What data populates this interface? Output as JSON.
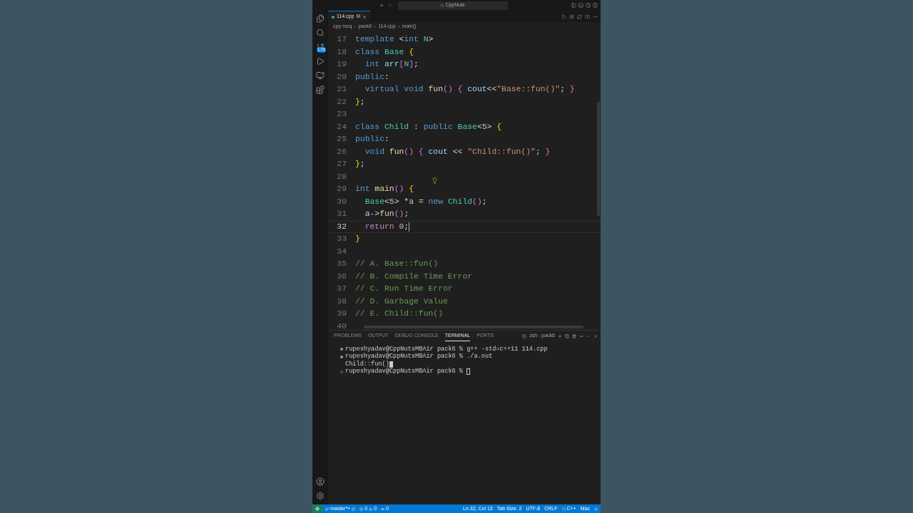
{
  "title_bar": {
    "search": "CppNuts"
  },
  "activity_bar": {
    "scm_badge": "176"
  },
  "tabs": [
    {
      "label": "114.cpp",
      "status": "M",
      "selected": true
    }
  ],
  "breadcrumbs": [
    "cpp mcq",
    "pack6",
    "114.cpp",
    "main()"
  ],
  "editor": {
    "lines": [
      {
        "number": "17",
        "current": false,
        "tokens": [
          {
            "text": "template",
            "kind": "kw"
          },
          {
            "text": " <",
            "kind": "p"
          },
          {
            "text": "int",
            "kind": "kw"
          },
          {
            "text": " N",
            "kind": "type"
          },
          {
            "text": ">",
            "kind": "p"
          }
        ]
      },
      {
        "number": "18",
        "current": false,
        "tokens": [
          {
            "text": "class",
            "kind": "kw"
          },
          {
            "text": " Base",
            "kind": "type"
          },
          {
            "text": " {",
            "kind": "b1"
          }
        ]
      },
      {
        "number": "19",
        "current": false,
        "tokens": [
          {
            "text": "  int",
            "kind": "kw"
          },
          {
            "text": " arr",
            "kind": "var"
          },
          {
            "text": "[",
            "kind": "b2"
          },
          {
            "text": "N",
            "kind": "type"
          },
          {
            "text": "]",
            "kind": "b2"
          },
          {
            "text": ";",
            "kind": "p"
          }
        ]
      },
      {
        "number": "20",
        "current": false,
        "tokens": [
          {
            "text": "public",
            "kind": "kw"
          },
          {
            "text": ":",
            "kind": "p"
          }
        ]
      },
      {
        "number": "21",
        "current": false,
        "tokens": [
          {
            "text": "  virtual void",
            "kind": "kw"
          },
          {
            "text": " fun",
            "kind": "fn"
          },
          {
            "text": "() {",
            "kind": "b2"
          },
          {
            "text": " cout",
            "kind": "var"
          },
          {
            "text": "<<",
            "kind": "p"
          },
          {
            "text": "\"Base::fun()\"",
            "kind": "str"
          },
          {
            "text": "; ",
            "kind": "p"
          },
          {
            "text": "}",
            "kind": "b2"
          }
        ]
      },
      {
        "number": "22",
        "current": false,
        "tokens": [
          {
            "text": "}",
            "kind": "b1"
          },
          {
            "text": ";",
            "kind": "p"
          }
        ]
      },
      {
        "number": "23",
        "current": false
      },
      {
        "number": "24",
        "current": false,
        "tokens": [
          {
            "text": "class",
            "kind": "kw"
          },
          {
            "text": " Child",
            "kind": "type"
          },
          {
            "text": " : ",
            "kind": "p"
          },
          {
            "text": "public",
            "kind": "kw"
          },
          {
            "text": " Base",
            "kind": "type"
          },
          {
            "text": "<",
            "kind": "p"
          },
          {
            "text": "5",
            "kind": "num"
          },
          {
            "text": "> ",
            "kind": "p"
          },
          {
            "text": "{",
            "kind": "b1"
          }
        ]
      },
      {
        "number": "25",
        "current": false,
        "tokens": [
          {
            "text": "public",
            "kind": "kw"
          },
          {
            "text": ":",
            "kind": "p"
          }
        ]
      },
      {
        "number": "26",
        "current": false,
        "tokens": [
          {
            "text": "  void",
            "kind": "kw"
          },
          {
            "text": " fun",
            "kind": "fn"
          },
          {
            "text": "() {",
            "kind": "b2"
          },
          {
            "text": " cout",
            "kind": "var"
          },
          {
            "text": " << ",
            "kind": "p"
          },
          {
            "text": "\"Child::fun()\"",
            "kind": "str"
          },
          {
            "text": "; ",
            "kind": "p"
          },
          {
            "text": "}",
            "kind": "b2"
          }
        ]
      },
      {
        "number": "27",
        "current": false,
        "tokens": [
          {
            "text": "}",
            "kind": "b1"
          },
          {
            "text": ";",
            "kind": "p"
          }
        ]
      },
      {
        "number": "28",
        "current": false
      },
      {
        "number": "29",
        "current": false,
        "tokens": [
          {
            "text": "int",
            "kind": "kw"
          },
          {
            "text": " main",
            "kind": "fn"
          },
          {
            "text": "()",
            "kind": "b2"
          },
          {
            "text": " {",
            "kind": "b1"
          }
        ]
      },
      {
        "number": "30",
        "current": false,
        "tokens": [
          {
            "text": "  Base",
            "kind": "type"
          },
          {
            "text": "<",
            "kind": "p"
          },
          {
            "text": "5",
            "kind": "num"
          },
          {
            "text": "> *",
            "kind": "p"
          },
          {
            "text": "a",
            "kind": "var"
          },
          {
            "text": " = ",
            "kind": "p"
          },
          {
            "text": "new",
            "kind": "kw"
          },
          {
            "text": " Child",
            "kind": "type"
          },
          {
            "text": "()",
            "kind": "b2"
          },
          {
            "text": ";",
            "kind": "p"
          }
        ]
      },
      {
        "number": "31",
        "current": false,
        "tokens": [
          {
            "text": "  a",
            "kind": "var"
          },
          {
            "text": "->",
            "kind": "p"
          },
          {
            "text": "fun",
            "kind": "fn"
          },
          {
            "text": "()",
            "kind": "b2"
          },
          {
            "text": ";",
            "kind": "p"
          }
        ]
      },
      {
        "number": "32",
        "current": true,
        "tokens": [
          {
            "text": "  return",
            "kind": "ctrl"
          },
          {
            "text": " 0",
            "kind": "num"
          },
          {
            "text": ";",
            "kind": "p"
          }
        ]
      },
      {
        "number": "33",
        "current": false,
        "tokens": [
          {
            "text": "}",
            "kind": "b1"
          }
        ]
      },
      {
        "number": "34",
        "current": false
      },
      {
        "number": "35",
        "current": false,
        "tokens": [
          {
            "text": "// A. Base::fun()",
            "kind": "cmt"
          }
        ]
      },
      {
        "number": "36",
        "current": false,
        "tokens": [
          {
            "text": "// B. Compile Time Error",
            "kind": "cmt"
          }
        ]
      },
      {
        "number": "37",
        "current": false,
        "tokens": [
          {
            "text": "// C. Run Time Error",
            "kind": "cmt"
          }
        ]
      },
      {
        "number": "38",
        "current": false,
        "tokens": [
          {
            "text": "// D. Garbage Value",
            "kind": "cmt"
          }
        ]
      },
      {
        "number": "39",
        "current": false,
        "tokens": [
          {
            "text": "// E. Child::fun()",
            "kind": "cmt"
          }
        ]
      },
      {
        "number": "40",
        "current": false
      }
    ]
  },
  "panel": {
    "tabs": [
      {
        "label": "PROBLEMS",
        "selected": false
      },
      {
        "label": "OUTPUT",
        "selected": false
      },
      {
        "label": "DEBUG CONSOLE",
        "selected": false
      },
      {
        "label": "TERMINAL",
        "selected": true
      },
      {
        "label": "PORTS",
        "selected": false
      }
    ],
    "terminal_name": "zsh - pack6",
    "terminal_lines": [
      {
        "kind": "command",
        "text": "rupeshyadav@CppNutsMBAir pack6 % g++ -std=c++11 114.cpp"
      },
      {
        "kind": "command",
        "text": "rupeshyadav@CppNutsMBAir pack6 % ./a.out"
      },
      {
        "kind": "output",
        "text": "Child::fun()"
      },
      {
        "kind": "prompt",
        "text": "rupeshyadav@CppNutsMBAir pack6 %"
      }
    ]
  },
  "status_bar": {
    "branch": "master*+",
    "errors": "0",
    "warnings": "0",
    "ports": "0",
    "position": "Ln 32, Col 13",
    "tab_size": "Tab Size: 2",
    "encoding": "UTF-8",
    "eol": "CRLF",
    "language": "C++",
    "platform": "Mac"
  }
}
